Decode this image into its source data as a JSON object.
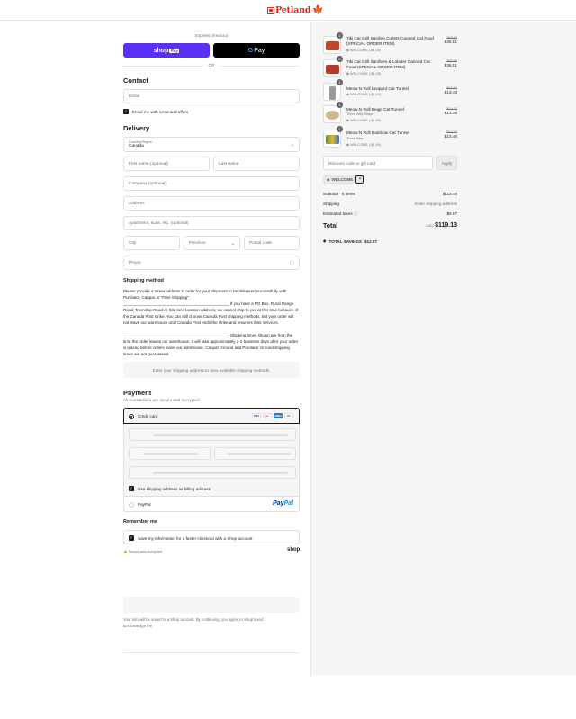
{
  "header": {
    "brand": "Petland"
  },
  "express": {
    "title": "Express checkout",
    "shop_pay_label": "shop",
    "shop_pay_badge": "Pay",
    "gpay_label": "Pay",
    "or_label": "OR"
  },
  "contact": {
    "heading": "Contact",
    "email_placeholder": "Email",
    "newsletter_label": "Email me with news and offers"
  },
  "delivery": {
    "heading": "Delivery",
    "country_label": "Country/Region",
    "country_value": "Canada",
    "first_name": "First name (optional)",
    "last_name": "Last name",
    "company": "Company (optional)",
    "address": "Address",
    "apartment": "Apartment, suite, etc. (optional)",
    "city": "City",
    "province": "Province",
    "postal": "Postal code",
    "phone": "Phone"
  },
  "shipping": {
    "heading": "Shipping method",
    "para1": "Please provide a street address in order for your shipment to be delivered successfully with Purolator, Canpar or \"Free Shipping\".",
    "para2": "_______________________________________________ If you have a PO Box, Rural Range Road, Township Road or Site land location address, we cannot ship to you at this time because of the Canada Post strike. You can still choose Canada Post shipping methods, but your order will not leave our warehouse until Canada Post ends the strike and resumes their services.",
    "para3": "_______________________________________________ Shipping times shown are from the time the order leaves our warehouse. It will take approximately 2-4 business days after your order is placed before orders leave our warehouse. Canpar Ground and Purolator Ground shipping times are not guaranteed.",
    "note": "Enter your shipping address to view available shipping methods."
  },
  "payment": {
    "heading": "Payment",
    "subtitle": "All transactions are secure and encrypted.",
    "credit_card_label": "Credit card",
    "billing_same_label": "Use shipping address as billing address",
    "paypal_label": "PayPal",
    "card_icons": [
      "VISA",
      "MC",
      "AMEX",
      "DC"
    ]
  },
  "remember": {
    "heading": "Remember me",
    "save_label": "Save my information for a faster checkout with a Shop account",
    "secure_label": "Secure and encrypted",
    "shop_logo": "shop"
  },
  "legal": {
    "text": "Your info will be saved to a Shop account. By continuing, you agree to Shop's and acknowledge the"
  },
  "cart": {
    "items": [
      {
        "qty": "2",
        "name": "Tiki Cat Grill Sardine Cutlets Canned Cat Food (SPECIAL ORDER ITEM)",
        "variant": "",
        "discount": "WELCOME (-$4.05)",
        "old_price": "$40.56",
        "price": "$36.51",
        "color": "#c2452d"
      },
      {
        "qty": "2",
        "name": "Tiki Cat Grill Sardines & Lobster Canned Cat Food (SPECIAL ORDER ITEM)",
        "variant": "",
        "discount": "WELCOME (-$4.05)",
        "old_price": "$40.56",
        "price": "$36.51",
        "color": "#b5382a"
      },
      {
        "qty": "1",
        "name": "Meow N Roll Leopard Cat Tunnel",
        "variant": "",
        "discount": "WELCOME (-$1.49)",
        "old_price": "$14.97",
        "price": "$13.48",
        "color": "#9a9a9a"
      },
      {
        "qty": "1",
        "name": "Meow N Roll Beige Cat Tunnel",
        "variant": "Three Way Shape",
        "discount": "WELCOME (-$1.49)",
        "old_price": "$14.97",
        "price": "$13.48",
        "color": "#cdb88f"
      },
      {
        "qty": "1",
        "name": "Meow N Roll Rainbow Cat Tunnel",
        "variant": "Three Way",
        "discount": "WELCOME (-$1.49)",
        "old_price": "$14.97",
        "price": "$13.48",
        "color": "#5b8f3d"
      }
    ],
    "discount_placeholder": "Discount code or gift card",
    "apply_label": "Apply",
    "applied_code": "WELCOME",
    "subtotal_label": "Subtotal · 5 items",
    "subtotal_value": "$113.46",
    "shipping_label": "Shipping",
    "shipping_value": "Enter shipping address",
    "taxes_label": "Estimated taxes",
    "taxes_value": "$5.67",
    "total_label": "Total",
    "currency": "CAD",
    "total_value": "$119.13",
    "savings_label": "TOTAL SAVINGS",
    "savings_value": "$12.57"
  }
}
